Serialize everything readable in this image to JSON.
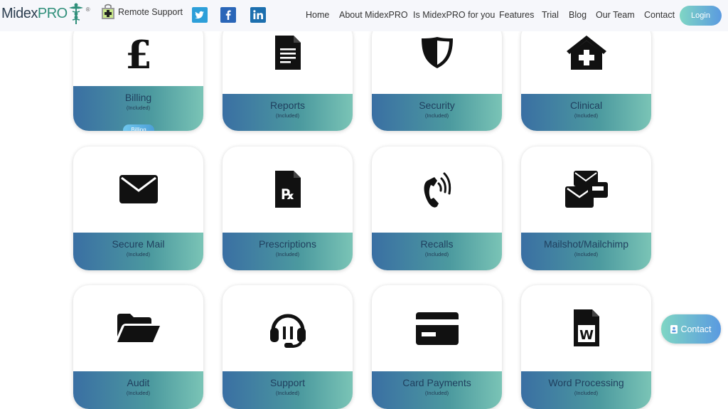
{
  "brand": {
    "name_part1": "Midex",
    "name_part2": "PRO",
    "reg": "®"
  },
  "header": {
    "remote_support": "Remote Support",
    "menu": [
      "Home",
      "About MidexPRO",
      "Is MidexPRO for you",
      "Features",
      "Trial",
      "Blog",
      "Our Team",
      "Contact"
    ],
    "login": "Login"
  },
  "cards": [
    {
      "title": "Billing",
      "sub": "(Included)",
      "icon": "pound-icon"
    },
    {
      "title": "Reports",
      "sub": "(Included)",
      "icon": "document-icon"
    },
    {
      "title": "Security",
      "sub": "(Included)",
      "icon": "shield-icon"
    },
    {
      "title": "Clinical",
      "sub": "(Included)",
      "icon": "medical-house-icon"
    },
    {
      "title": "Secure Mail",
      "sub": "(Included)",
      "icon": "envelope-icon"
    },
    {
      "title": "Prescriptions",
      "sub": "(Included)",
      "icon": "prescription-icon"
    },
    {
      "title": "Recalls",
      "sub": "(Included)",
      "icon": "phone-ringing-icon"
    },
    {
      "title": "Mailshot/Mailchimp",
      "sub": "(Included)",
      "icon": "mailbox-icon"
    },
    {
      "title": "Audit",
      "sub": "(Included)",
      "icon": "folder-open-icon"
    },
    {
      "title": "Support",
      "sub": "(Included)",
      "icon": "headset-icon"
    },
    {
      "title": "Card Payments",
      "sub": "(Included)",
      "icon": "credit-card-icon"
    },
    {
      "title": "Word Processing",
      "sub": "(Included)",
      "icon": "word-file-icon"
    }
  ],
  "billing_pill": "Billing",
  "contact_button": "Contact",
  "colors": {
    "accent_start": "#7fd6c4",
    "accent_end": "#5a9ae0",
    "band_start": "#3a6fa3",
    "band_end": "#7ac4b6"
  }
}
